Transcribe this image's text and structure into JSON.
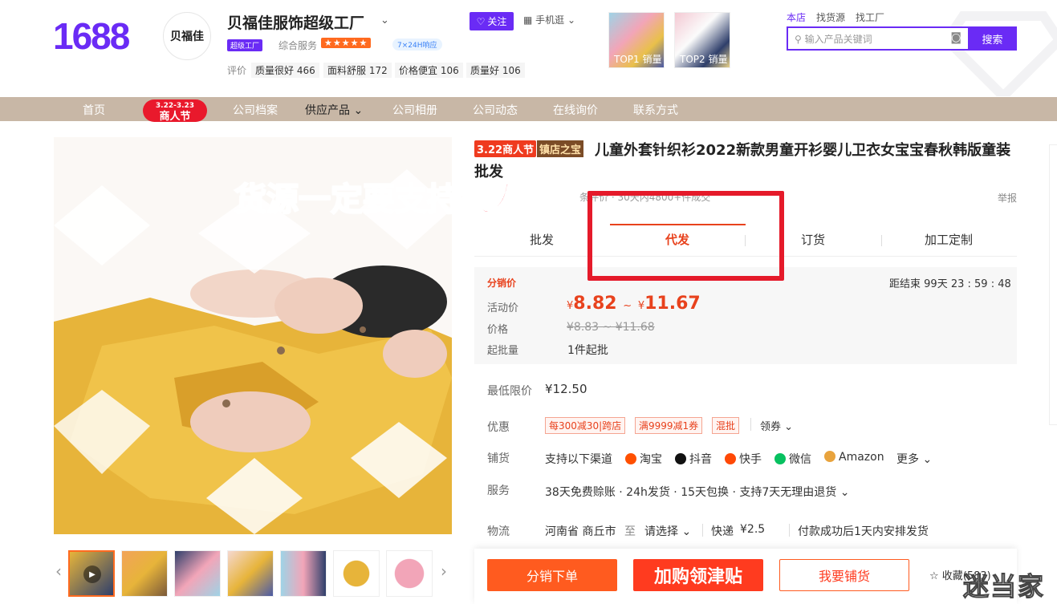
{
  "header": {
    "logo": "1688",
    "shop_logo_text": "贝福佳",
    "shop_name": "贝福佳服饰超级工厂",
    "follow": "关注",
    "mobile": "手机逛",
    "super_factory_badge": "超级工厂",
    "service_label": "综合服务",
    "stars": "★★★★★",
    "response_badge": "7×24H响应",
    "eval_label": "评价",
    "eval_tags": [
      "质量很好 466",
      "面料舒服 172",
      "价格便宜 106",
      "质量好 106"
    ],
    "top_products": [
      "TOP1 销量",
      "TOP2 销量"
    ],
    "search_tabs": [
      "本店",
      "找货源",
      "找工厂"
    ],
    "search_placeholder": "输入产品关键词",
    "search_button": "搜索"
  },
  "nav": {
    "items": [
      "首页",
      "公司档案",
      "供应产品",
      "公司相册",
      "公司动态",
      "在线询价",
      "联系方式"
    ],
    "festival_dates": "3.22-3.23",
    "festival_name": "商人节"
  },
  "product": {
    "tag_festival": "3.22商人节",
    "tag_treasure": "镇店之宝",
    "title": "儿童外套针织衫2022新款男童开衫婴儿卫衣女宝宝春秋韩版童装批发",
    "overlay_caption": "货源一定要支持代发",
    "meta_line": "条评价 · 30天内4800+件成交",
    "report": "举报",
    "tabs": [
      "批发",
      "代发",
      "订货",
      "加工定制"
    ],
    "active_tab": "代发",
    "dist_price_label": "分销价",
    "countdown_label": "距结束",
    "countdown": "99天 23 : 59 : 48",
    "activity_price_label": "活动价",
    "price_symbol": "¥",
    "price_low": "8.82",
    "price_sep": "~",
    "price_high": "11.67",
    "price_label": "价格",
    "old_price": "¥8.83 ~ ¥11.68",
    "moq_label": "起批量",
    "moq": "1件起批",
    "min_price_label": "最低限价",
    "min_price": "¥12.50",
    "promo_label": "优惠",
    "coupons": [
      "每300减30|跨店",
      "满9999减1券",
      "混批"
    ],
    "get_coupon": "领券",
    "channel_label": "铺货",
    "channel_intro": "支持以下渠道",
    "channels": [
      {
        "name": "淘宝",
        "color": "#ff5000"
      },
      {
        "name": "抖音",
        "color": "#111111"
      },
      {
        "name": "快手",
        "color": "#ff4906"
      },
      {
        "name": "微信",
        "color": "#07c160"
      },
      {
        "name": "Amazon",
        "color": "#e8a33d"
      }
    ],
    "more": "更多",
    "service_label": "服务",
    "services": "38天免费赊账 · 24h发货 · 15天包换 · 支持7天无理由退货",
    "logistics_label": "物流",
    "origin": "河南省 商丘市",
    "to": "至",
    "dest": "请选择",
    "express": "快递",
    "fee": "¥2.5",
    "ship_note": "付款成功后1天内安排发货"
  },
  "actions": {
    "distribute_order": "分销下单",
    "coupon_banner": "加购领津贴",
    "stock_up": "我要铺货",
    "collect": "收藏(583)"
  },
  "watermark": "迷当家"
}
